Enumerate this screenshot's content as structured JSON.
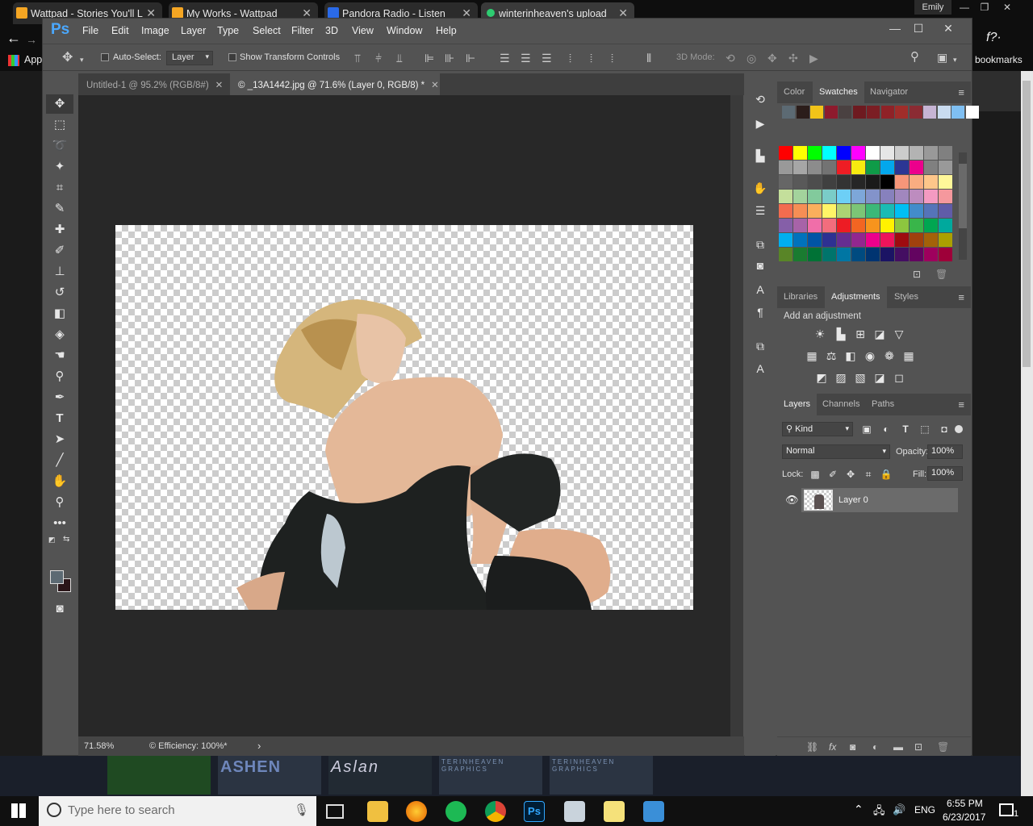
{
  "browser": {
    "tabs": [
      {
        "title": "Wattpad - Stories You'll L",
        "icon": "wattpad-icon",
        "color": "#f5a623"
      },
      {
        "title": "My Works - Wattpad",
        "icon": "wattpad-icon",
        "color": "#f5a623"
      },
      {
        "title": "Pandora Radio - Listen",
        "icon": "pandora-icon",
        "color": "#2a6ae8"
      },
      {
        "title": "winterinheaven's upload",
        "icon": "record-icon",
        "color": "#2ecc71"
      }
    ],
    "user": "Emily",
    "apps_label": "App",
    "bookmarks_label": "bookmarks",
    "side_text": "f?·",
    "thumbs": [
      "ASHEN",
      "Aslan",
      "TERINHEAVEN GRAPHICS",
      "TERINHEAVEN GRAPHICS"
    ]
  },
  "ps": {
    "logo": "Ps",
    "menu": [
      "File",
      "Edit",
      "Image",
      "Layer",
      "Type",
      "Select",
      "Filter",
      "3D",
      "View",
      "Window",
      "Help"
    ],
    "options": {
      "auto_select_label": "Auto-Select:",
      "auto_select_value": "Layer",
      "transform_label": "Show Transform Controls",
      "mode_3d_label": "3D Mode:"
    },
    "doc_tabs": [
      {
        "label": "Untitled-1 @ 95.2% (RGB/8#)",
        "active": false
      },
      {
        "label": "© _13A1442.jpg @ 71.6% (Layer 0, RGB/8) *",
        "active": true
      }
    ],
    "status": {
      "zoom": "71.58%",
      "info": "© Efficiency: 100%*"
    },
    "panels": {
      "top_tabs": [
        "Color",
        "Swatches",
        "Navigator"
      ],
      "top_active": "Swatches",
      "mid_tabs": [
        "Libraries",
        "Adjustments",
        "Styles"
      ],
      "mid_active": "Adjustments",
      "adj_title": "Add an adjustment",
      "layers_tabs": [
        "Layers",
        "Channels",
        "Paths"
      ],
      "layers_active": "Layers",
      "filter_kind": "Kind",
      "blend_mode": "Normal",
      "opacity_label": "Opacity:",
      "opacity_value": "100%",
      "lock_label": "Lock:",
      "fill_label": "Fill:",
      "fill_value": "100%",
      "layer_name": "Layer 0"
    },
    "swatch_colors": {
      "recent": [
        "#5c6a73",
        "#2b1d1a",
        "#f2c419",
        "#8e1a2d",
        "#4a4141",
        "#6e1a20",
        "#7b1e24",
        "#8f2227",
        "#a02d2a",
        "#8b2b33",
        "#c6b4d4",
        "#c9dbef",
        "#7fbff2",
        "#ffffff"
      ],
      "grid": [
        [
          "#ff0000",
          "#ffff00",
          "#00ff00",
          "#00ffff",
          "#0000ff",
          "#ff00ff",
          "#ffffff",
          "#e6e6e6",
          "#cccccc",
          "#b3b3b3",
          "#999999",
          "#808080"
        ],
        [
          "#999999",
          "#a6a6a6",
          "#8c8c8c",
          "#737373",
          "#ee1d24",
          "#f8eb10",
          "#0f9b48",
          "#03a7ec",
          "#2b3694",
          "#ec008c",
          "#808080",
          "#999999"
        ],
        [
          "#666666",
          "#595959",
          "#4d4d4d",
          "#404040",
          "#333333",
          "#262626",
          "#1a1a1a",
          "#000000",
          "#f69679",
          "#f9ad81",
          "#fdc68a",
          "#fff799"
        ],
        [
          "#c4df9b",
          "#a3d39c",
          "#82ca9c",
          "#7accc8",
          "#6dcff6",
          "#7da7d9",
          "#8393ca",
          "#8781bd",
          "#a187be",
          "#bd8cbf",
          "#f49ac1",
          "#f5989d"
        ],
        [
          "#f26c4f",
          "#f68e55",
          "#fbaf5c",
          "#fff467",
          "#acd373",
          "#7cc576",
          "#3bb878",
          "#1abbb4",
          "#00bff3",
          "#438ccb",
          "#5574b9",
          "#605ca8"
        ],
        [
          "#855fa8",
          "#a763a8",
          "#f06ea9",
          "#f26d7d",
          "#ed1c24",
          "#f26522",
          "#f7941d",
          "#fff200",
          "#8dc63f",
          "#39b54a",
          "#00a651",
          "#00a99d"
        ],
        [
          "#00aeef",
          "#0072bc",
          "#0054a6",
          "#2e3192",
          "#662d91",
          "#92278f",
          "#ec008c",
          "#ed145b",
          "#9e0b0f",
          "#a0410d",
          "#a36209",
          "#aba000"
        ],
        [
          "#598527",
          "#1a7b30",
          "#007236",
          "#00746b",
          "#0076a3",
          "#004b80",
          "#003471",
          "#1b1464",
          "#440e62",
          "#630460",
          "#9e005d",
          "#9e0039"
        ]
      ]
    }
  },
  "taskbar": {
    "search_placeholder": "Type here to search",
    "lang": "ENG",
    "time": "6:55 PM",
    "date": "6/23/2017",
    "notif_count": "1"
  }
}
